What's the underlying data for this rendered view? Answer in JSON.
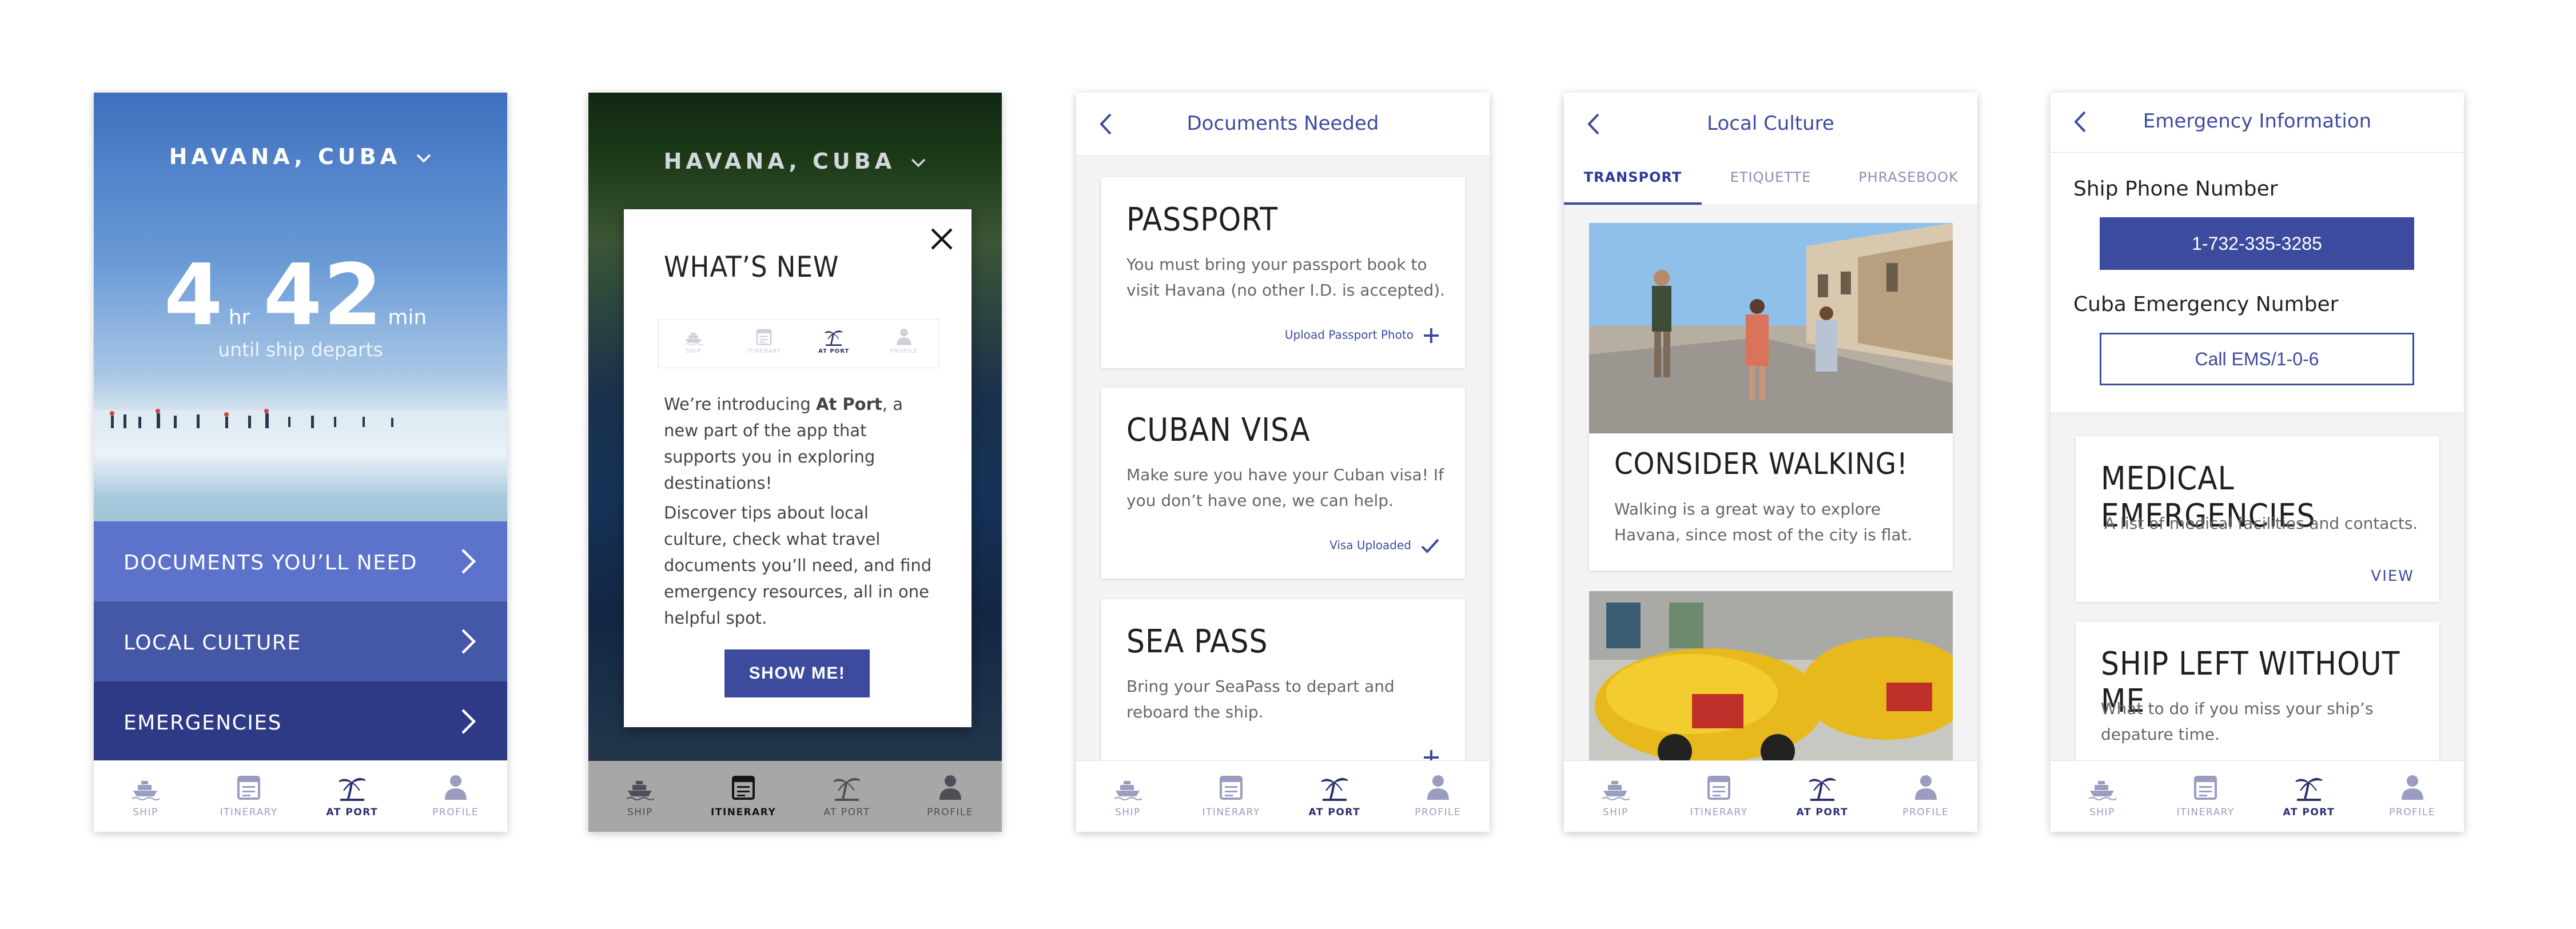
{
  "nav": [
    {
      "label": "SHIP",
      "icon": "ship-icon"
    },
    {
      "label": "ITINERARY",
      "icon": "calendar-icon"
    },
    {
      "label": "AT PORT",
      "icon": "palm-tree-icon"
    },
    {
      "label": "PROFILE",
      "icon": "person-icon"
    }
  ],
  "screen1": {
    "city": "HAVANA, CUBA",
    "hours": "4",
    "hours_unit": "hr",
    "minutes": "42",
    "minutes_unit": "min",
    "until": "until ship departs",
    "menu": [
      {
        "label": "DOCUMENTS YOU’LL NEED",
        "color": "#5d73cb"
      },
      {
        "label": "LOCAL CULTURE",
        "color": "#4557a7"
      },
      {
        "label": "EMERGENCIES",
        "color": "#2f3a86"
      }
    ]
  },
  "screen2": {
    "city": "HAVANA, CUBA",
    "title": "WHAT’S NEW",
    "intro_prefix": "We’re introducing ",
    "intro_bold": "At Port",
    "intro_suffix": ", a new part of the app that supports you in exploring destinations!",
    "body": "Discover tips about local culture, check what travel documents you’ll need, and find emergency resources, all in one helpful spot.",
    "button": "SHOW ME!"
  },
  "screen3": {
    "title": "Documents Needed",
    "cards": [
      {
        "heading": "PASSPORT",
        "body": "You must bring your passport book to visit Havana (no other I.D. is accepted).",
        "action": "Upload Passport Photo"
      },
      {
        "heading": "CUBAN VISA",
        "body": "Make sure you have your Cuban visa! If you don’t have one, we can help.",
        "action": "Visa Uploaded"
      },
      {
        "heading": "SEA PASS",
        "body": "Bring your SeaPass to depart and reboard the ship."
      }
    ]
  },
  "screen4": {
    "title": "Local Culture",
    "tabs": [
      "TRANSPORT",
      "ETIQUETTE",
      "PHRASEBOOK"
    ],
    "card_heading": "CONSIDER WALKING!",
    "card_body": "Walking is a great way to explore Havana, since most of the city is flat."
  },
  "screen5": {
    "title": "Emergency Information",
    "ship_phone_label": "Ship Phone Number",
    "ship_phone": "1-732-335-3285",
    "cuba_label": "Cuba Emergency Number",
    "cuba_button": "Call EMS/1-0-6",
    "cards": [
      {
        "heading": "MEDICAL EMERGENCIES",
        "body": "A list of medical facilities and contacts.",
        "action": "VIEW"
      },
      {
        "heading": "SHIP LEFT WITHOUT ME",
        "body": "What to do if you miss your ship’s depature time."
      }
    ]
  },
  "colors": {
    "primary": "#3c4b9e",
    "nav_active": "#2a2f6e",
    "nav_inactive": "#9a9cc0"
  }
}
